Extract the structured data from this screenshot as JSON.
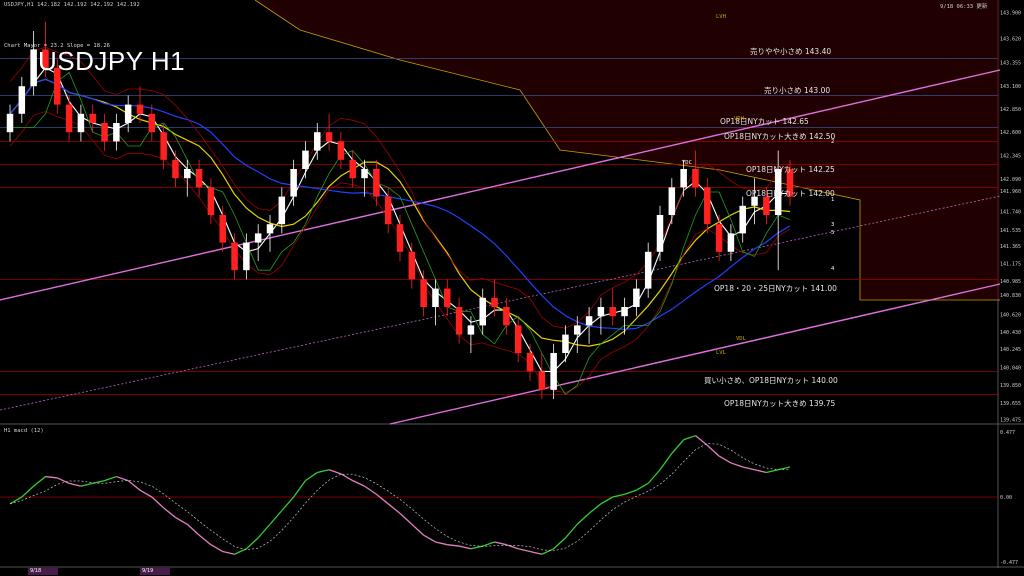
{
  "header": {
    "symbol_info": "USDJPY,H1  142.182 142.192 142.192 142.192",
    "timestamp": "9/18 06:33 更新",
    "indicator": "Chart Mayor = 23.2 Slope = 18.26",
    "title": "USDJPY H1"
  },
  "macd_label": "H1 macd (12)",
  "chart_data": {
    "type": "candlestick",
    "title": "USDJPY H1",
    "ylim": [
      139.45,
      143.95
    ],
    "y_ticks": [
      "143.900",
      "143.620",
      "143.355",
      "143.100",
      "142.850",
      "142.600",
      "142.345",
      "142.090",
      "141.960",
      "141.740",
      "141.535",
      "141.365",
      "141.175",
      "140.985",
      "140.830",
      "140.620",
      "140.430",
      "140.245",
      "140.040",
      "139.850",
      "139.655",
      "139.475"
    ],
    "levels": [
      {
        "label": "売りやや小さめ 143.40",
        "value": 143.4,
        "color": "#3a4d8c"
      },
      {
        "label": "売り小さめ 143.00",
        "value": 143.0,
        "color": "#3a4d8c"
      },
      {
        "label": "OP18日NYカット 142.65",
        "value": 142.65,
        "color": "#3a4d8c"
      },
      {
        "label": "OP18日NYカット大きめ 142.50",
        "value": 142.5,
        "color": "#a00000"
      },
      {
        "label": "OP18日NYカット 142.25",
        "value": 142.25,
        "color": "#a00000"
      },
      {
        "label": "OP18日NYカット 142.00",
        "value": 142.0,
        "color": "#a00000"
      },
      {
        "label": "OP18・20・25日NYカット 141.00",
        "value": 141.0,
        "color": "#a00000"
      },
      {
        "label": "買い小さめ、OP18日NYカット 140.00",
        "value": 140.0,
        "color": "#a00000"
      },
      {
        "label": "OP18日NYカット大きめ 139.75",
        "value": 139.75,
        "color": "#a00000"
      }
    ],
    "candles": [
      [
        142.6,
        142.9,
        142.5,
        142.8
      ],
      [
        142.8,
        143.2,
        142.7,
        143.1
      ],
      [
        143.1,
        143.7,
        143.0,
        143.5
      ],
      [
        143.5,
        143.8,
        143.2,
        143.3
      ],
      [
        143.3,
        143.4,
        142.8,
        142.9
      ],
      [
        142.9,
        143.0,
        142.5,
        142.6
      ],
      [
        142.6,
        142.9,
        142.5,
        142.8
      ],
      [
        142.8,
        142.9,
        142.6,
        142.7
      ],
      [
        142.7,
        142.8,
        142.4,
        142.5
      ],
      [
        142.5,
        142.8,
        142.4,
        142.7
      ],
      [
        142.7,
        143.0,
        142.6,
        142.9
      ],
      [
        142.9,
        143.1,
        142.7,
        142.8
      ],
      [
        142.8,
        142.9,
        142.5,
        142.6
      ],
      [
        142.6,
        142.7,
        142.2,
        142.3
      ],
      [
        142.3,
        142.4,
        142.0,
        142.1
      ],
      [
        142.1,
        142.3,
        141.9,
        142.2
      ],
      [
        142.2,
        142.3,
        141.9,
        142.0
      ],
      [
        142.0,
        142.1,
        141.6,
        141.7
      ],
      [
        141.7,
        141.8,
        141.3,
        141.4
      ],
      [
        141.4,
        141.5,
        141.0,
        141.1
      ],
      [
        141.1,
        141.5,
        141.0,
        141.4
      ],
      [
        141.4,
        141.6,
        141.2,
        141.5
      ],
      [
        141.5,
        141.7,
        141.3,
        141.6
      ],
      [
        141.6,
        142.0,
        141.5,
        141.9
      ],
      [
        141.9,
        142.3,
        141.8,
        142.2
      ],
      [
        142.2,
        142.5,
        142.1,
        142.4
      ],
      [
        142.4,
        142.7,
        142.3,
        142.6
      ],
      [
        142.6,
        142.8,
        142.4,
        142.5
      ],
      [
        142.5,
        142.6,
        142.2,
        142.3
      ],
      [
        142.3,
        142.4,
        142.0,
        142.1
      ],
      [
        142.1,
        142.3,
        141.9,
        142.2
      ],
      [
        142.2,
        142.3,
        141.8,
        141.9
      ],
      [
        141.9,
        142.0,
        141.5,
        141.6
      ],
      [
        141.6,
        141.7,
        141.2,
        141.3
      ],
      [
        141.3,
        141.4,
        140.9,
        141.0
      ],
      [
        141.0,
        141.1,
        140.6,
        140.7
      ],
      [
        140.7,
        141.0,
        140.5,
        140.9
      ],
      [
        140.9,
        141.0,
        140.6,
        140.7
      ],
      [
        140.7,
        140.8,
        140.3,
        140.4
      ],
      [
        140.4,
        140.6,
        140.2,
        140.5
      ],
      [
        140.5,
        140.9,
        140.4,
        140.8
      ],
      [
        140.8,
        141.0,
        140.6,
        140.7
      ],
      [
        140.7,
        140.8,
        140.4,
        140.5
      ],
      [
        140.5,
        140.6,
        140.1,
        140.2
      ],
      [
        140.2,
        140.3,
        139.9,
        140.0
      ],
      [
        140.0,
        140.2,
        139.7,
        139.8
      ],
      [
        139.8,
        140.3,
        139.7,
        140.2
      ],
      [
        140.2,
        140.5,
        140.1,
        140.4
      ],
      [
        140.4,
        140.6,
        140.2,
        140.5
      ],
      [
        140.5,
        140.7,
        140.3,
        140.6
      ],
      [
        140.6,
        140.8,
        140.4,
        140.7
      ],
      [
        140.7,
        140.9,
        140.5,
        140.6
      ],
      [
        140.6,
        140.8,
        140.4,
        140.7
      ],
      [
        140.7,
        141.0,
        140.6,
        140.9
      ],
      [
        140.9,
        141.4,
        140.8,
        141.3
      ],
      [
        141.3,
        141.8,
        141.2,
        141.7
      ],
      [
        141.7,
        142.1,
        141.6,
        142.0
      ],
      [
        142.0,
        142.3,
        141.9,
        142.2
      ],
      [
        142.2,
        142.4,
        141.9,
        142.0
      ],
      [
        142.0,
        142.1,
        141.5,
        141.6
      ],
      [
        141.6,
        141.7,
        141.2,
        141.3
      ],
      [
        141.3,
        141.6,
        141.2,
        141.5
      ],
      [
        141.5,
        141.9,
        141.4,
        141.8
      ],
      [
        141.8,
        142.1,
        141.6,
        141.9
      ],
      [
        141.9,
        142.0,
        141.6,
        141.7
      ],
      [
        141.7,
        142.4,
        141.1,
        142.2
      ],
      [
        142.2,
        142.3,
        141.8,
        141.9
      ]
    ]
  },
  "macd_data": {
    "ylim": [
      -0.477,
      0.477
    ],
    "y_ticks": [
      "0.477",
      "0.00",
      "-0.477"
    ],
    "values": [
      -0.05,
      0.0,
      0.08,
      0.15,
      0.14,
      0.1,
      0.08,
      0.1,
      0.12,
      0.15,
      0.12,
      0.05,
      0.0,
      -0.08,
      -0.15,
      -0.2,
      -0.28,
      -0.35,
      -0.4,
      -0.42,
      -0.38,
      -0.3,
      -0.2,
      -0.1,
      0.0,
      0.12,
      0.18,
      0.2,
      0.17,
      0.12,
      0.08,
      0.02,
      -0.05,
      -0.12,
      -0.2,
      -0.28,
      -0.33,
      -0.35,
      -0.36,
      -0.38,
      -0.36,
      -0.33,
      -0.35,
      -0.38,
      -0.4,
      -0.42,
      -0.38,
      -0.3,
      -0.2,
      -0.12,
      -0.05,
      0.0,
      0.02,
      0.05,
      0.1,
      0.2,
      0.32,
      0.42,
      0.45,
      0.38,
      0.3,
      0.25,
      0.22,
      0.2,
      0.18,
      0.2,
      0.22
    ]
  },
  "annotations": {
    "lvh": "LVH",
    "lvl": "LVL",
    "vdh": "VDH",
    "vdl": "VDL",
    "ydc": "YDC",
    "wave_nums": [
      "1",
      "2",
      "3",
      "4",
      "5"
    ]
  },
  "time_tabs": [
    "9/18",
    "9/19"
  ]
}
